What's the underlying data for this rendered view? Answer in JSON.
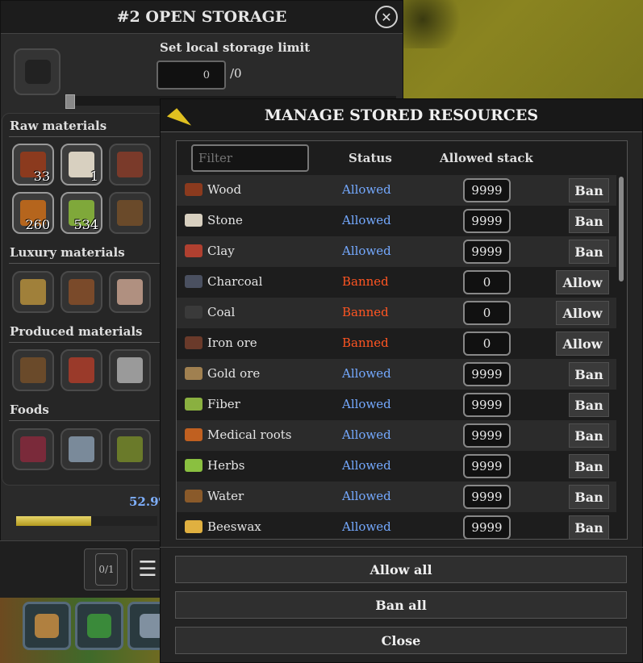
{
  "storage": {
    "title": "#2 OPEN STORAGE",
    "close_symbol": "✕",
    "limit_label": "Set local storage limit",
    "limit_value": "0",
    "limit_max": "/0",
    "categories": [
      {
        "name": "Raw materials"
      },
      {
        "name": "Luxury materials"
      },
      {
        "name": "Produced materials"
      },
      {
        "name": "Foods"
      }
    ],
    "raw_slots": [
      {
        "icon": "wood-icon",
        "count": "33",
        "color": "#8b3a1e"
      },
      {
        "icon": "stone-icon",
        "count": "1",
        "color": "#d8d0c0"
      },
      {
        "icon": "clay-icon",
        "count": "",
        "color": "#7a3a2a"
      },
      {
        "icon": "medical-roots-icon",
        "count": "260",
        "color": "#b5651d"
      },
      {
        "icon": "herbs-icon",
        "count": "534",
        "color": "#7fa83a"
      },
      {
        "icon": "water-icon",
        "count": "",
        "color": "#6a4a2a"
      }
    ],
    "luxury_slots": [
      {
        "icon": "candles-icon",
        "color": "#a0803a"
      },
      {
        "icon": "furniture-icon",
        "color": "#7a4a2a"
      },
      {
        "icon": "cloth-icon",
        "color": "#b09080"
      }
    ],
    "produced_slots": [
      {
        "icon": "planks-icon",
        "color": "#6a4a2a"
      },
      {
        "icon": "bricks-icon",
        "color": "#9a3a2a"
      },
      {
        "icon": "iron-bars-icon",
        "color": "#9a9a9a"
      }
    ],
    "food_slots": [
      {
        "icon": "berries-icon",
        "color": "#7a2a3a"
      },
      {
        "icon": "fish-icon",
        "color": "#7a8a9a"
      },
      {
        "icon": "cabbage-icon",
        "color": "#6a7a2a"
      }
    ],
    "fill_percent": "52.9",
    "fill_fraction": 0.529,
    "count_label": "0/1",
    "menu_symbol": "☰"
  },
  "tools": [
    {
      "icon": "build-icon"
    },
    {
      "icon": "gather-icon"
    },
    {
      "icon": "dig-icon"
    }
  ],
  "manage": {
    "title": "MANAGE STORED RESOURCES",
    "filter_placeholder": "Filter",
    "col_status": "Status",
    "col_stack": "Allowed stack",
    "rows": [
      {
        "name": "Wood",
        "status": "Allowed",
        "stack": "9999",
        "action": "Ban",
        "icon": "wood-icon",
        "color": "#8b3a1e"
      },
      {
        "name": "Stone",
        "status": "Allowed",
        "stack": "9999",
        "action": "Ban",
        "icon": "stone-icon",
        "color": "#d8d0c0"
      },
      {
        "name": "Clay",
        "status": "Allowed",
        "stack": "9999",
        "action": "Ban",
        "icon": "clay-icon",
        "color": "#b04030"
      },
      {
        "name": "Charcoal",
        "status": "Banned",
        "stack": "0",
        "action": "Allow",
        "icon": "charcoal-icon",
        "color": "#4a5060"
      },
      {
        "name": "Coal",
        "status": "Banned",
        "stack": "0",
        "action": "Allow",
        "icon": "coal-icon",
        "color": "#3a3a3a"
      },
      {
        "name": "Iron ore",
        "status": "Banned",
        "stack": "0",
        "action": "Allow",
        "icon": "iron-ore-icon",
        "color": "#6a3a2a"
      },
      {
        "name": "Gold ore",
        "status": "Allowed",
        "stack": "9999",
        "action": "Ban",
        "icon": "gold-ore-icon",
        "color": "#a08050"
      },
      {
        "name": "Fiber",
        "status": "Allowed",
        "stack": "9999",
        "action": "Ban",
        "icon": "fiber-icon",
        "color": "#8ab040"
      },
      {
        "name": "Medical roots",
        "status": "Allowed",
        "stack": "9999",
        "action": "Ban",
        "icon": "medical-roots-icon",
        "color": "#c06020"
      },
      {
        "name": "Herbs",
        "status": "Allowed",
        "stack": "9999",
        "action": "Ban",
        "icon": "herbs-icon",
        "color": "#8ac040"
      },
      {
        "name": "Water",
        "status": "Allowed",
        "stack": "9999",
        "action": "Ban",
        "icon": "water-icon",
        "color": "#8a5a2a"
      },
      {
        "name": "Beeswax",
        "status": "Allowed",
        "stack": "9999",
        "action": "Ban",
        "icon": "beeswax-icon",
        "color": "#e0b040"
      }
    ],
    "allow_all": "Allow all",
    "ban_all": "Ban all",
    "close": "Close"
  }
}
